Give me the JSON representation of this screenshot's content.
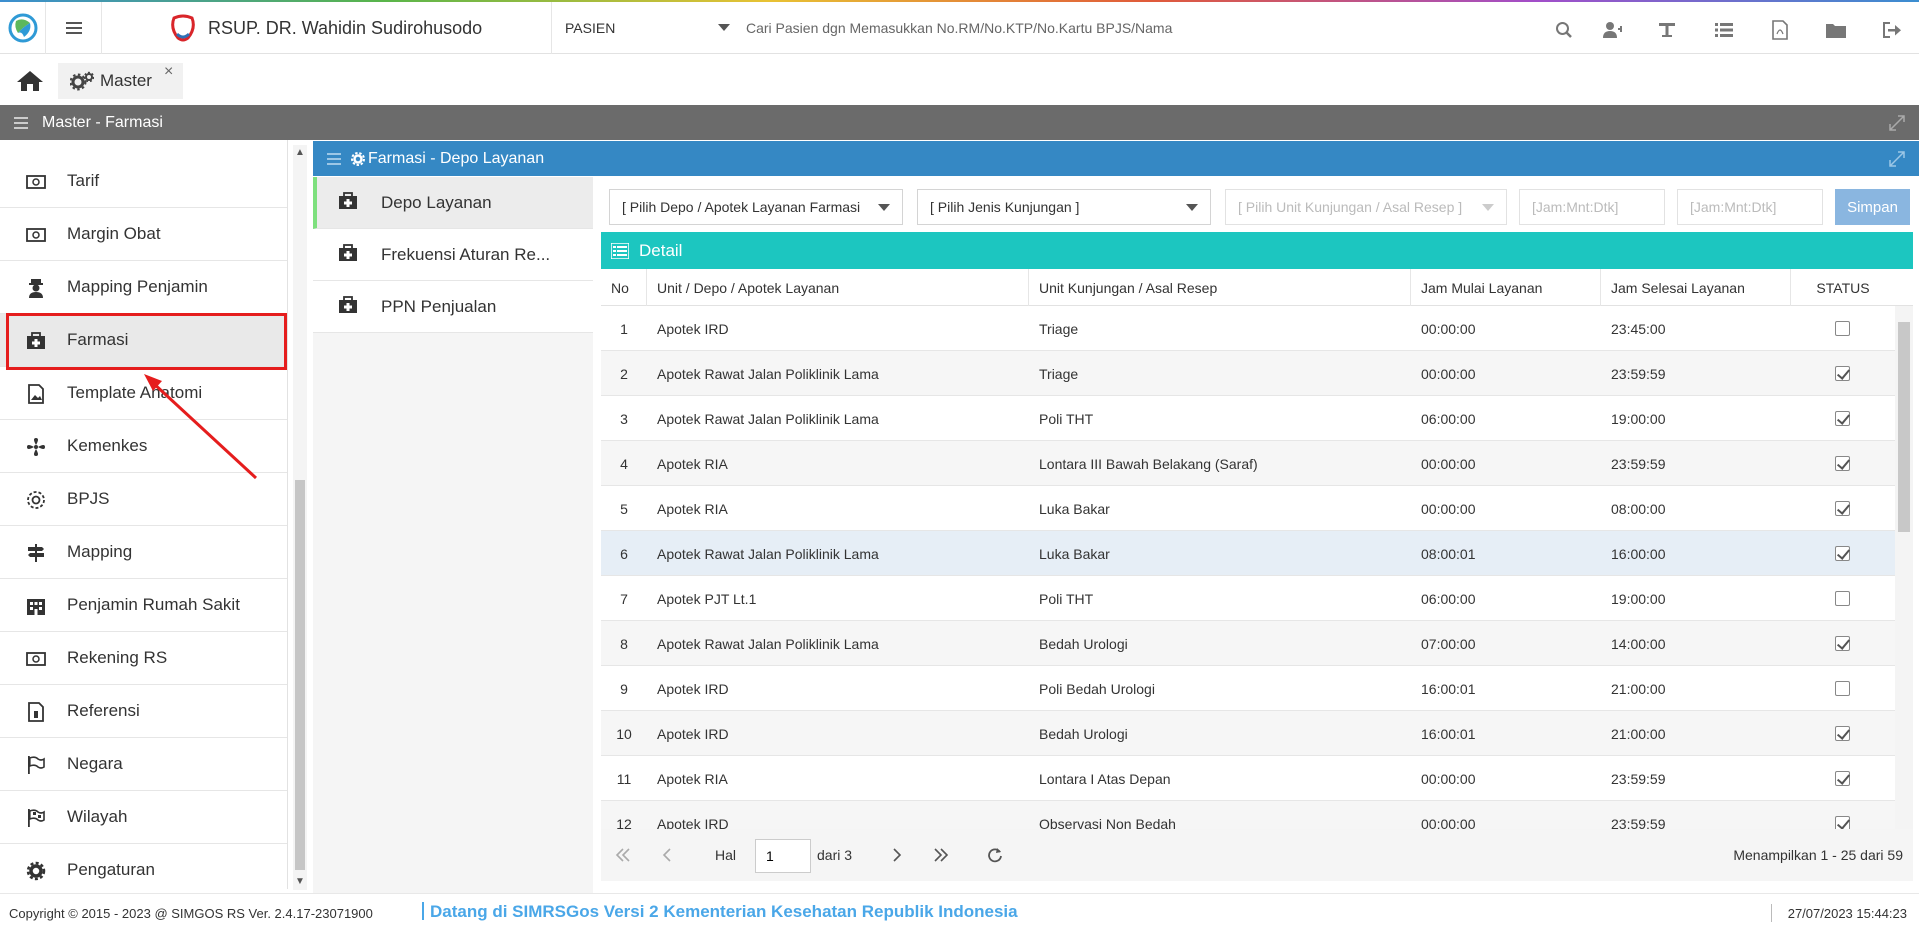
{
  "header": {
    "hospital_name": "RSUP. DR. Wahidin Sudirohusodo",
    "patient_type": "PASIEN",
    "search_placeholder": "Cari Pasien dgn Memasukkan No.RM/No.KTP/No.Kartu BPJS/Nama",
    "icons": [
      "search-icon",
      "add-user-icon",
      "text-icon",
      "list-icon",
      "pdf-icon",
      "folder-icon",
      "logout-icon"
    ]
  },
  "tabs": {
    "home_icon": "home-icon",
    "master_label": "Master",
    "close_glyph": "×"
  },
  "panel": {
    "title": "Master - Farmasi"
  },
  "sidebar": {
    "items": [
      {
        "label": "Tarif",
        "icon": "money-icon"
      },
      {
        "label": "Margin Obat",
        "icon": "money-icon"
      },
      {
        "label": "Mapping Penjamin",
        "icon": "user-secret-icon"
      },
      {
        "label": "Farmasi",
        "icon": "medkit-icon",
        "active": true
      },
      {
        "label": "Template Anatomi",
        "icon": "image-file-icon"
      },
      {
        "label": "Kemenkes",
        "icon": "fan-icon"
      },
      {
        "label": "BPJS",
        "icon": "life-ring-icon"
      },
      {
        "label": "Mapping",
        "icon": "signpost-icon"
      },
      {
        "label": "Penjamin Rumah Sakit",
        "icon": "building-icon"
      },
      {
        "label": "Rekening RS",
        "icon": "money-icon"
      },
      {
        "label": "Referensi",
        "icon": "document-icon"
      },
      {
        "label": "Negara",
        "icon": "flag-outline-icon"
      },
      {
        "label": "Wilayah",
        "icon": "flag-checkered-icon"
      },
      {
        "label": "Pengaturan",
        "icon": "gear-icon"
      }
    ]
  },
  "content": {
    "title": "Farmasi - Depo Layanan",
    "subnav": [
      {
        "label": "Depo Layanan",
        "active": true
      },
      {
        "label": "Frekuensi Aturan Re..."
      },
      {
        "label": "PPN Penjualan"
      }
    ]
  },
  "filters": {
    "depo": "[ Pilih Depo / Apotek Layanan Farmasi",
    "jenis": "[ Pilih Jenis Kunjungan ]",
    "unit": "[ Pilih Unit Kunjungan / Asal Resep ]",
    "jam_mulai_placeholder": "[Jam:Mnt:Dtk]",
    "jam_selesai_placeholder": "[Jam:Mnt:Dtk]",
    "simpan": "Simpan"
  },
  "detail": {
    "title": "Detail",
    "columns": [
      "No",
      "Unit / Depo / Apotek Layanan",
      "Unit Kunjungan / Asal Resep",
      "Jam Mulai Layanan",
      "Jam Selesai Layanan",
      "STATUS"
    ],
    "rows": [
      {
        "no": "1",
        "unit": "Apotek IRD",
        "asal": "Triage",
        "mulai": "00:00:00",
        "selesai": "23:45:00",
        "status": false
      },
      {
        "no": "2",
        "unit": "Apotek Rawat Jalan Poliklinik Lama",
        "asal": "Triage",
        "mulai": "00:00:00",
        "selesai": "23:59:59",
        "status": true
      },
      {
        "no": "3",
        "unit": "Apotek Rawat Jalan Poliklinik Lama",
        "asal": "Poli THT",
        "mulai": "06:00:00",
        "selesai": "19:00:00",
        "status": true
      },
      {
        "no": "4",
        "unit": "Apotek RIA",
        "asal": "Lontara III Bawah Belakang (Saraf)",
        "mulai": "00:00:00",
        "selesai": "23:59:59",
        "status": true
      },
      {
        "no": "5",
        "unit": "Apotek RIA",
        "asal": "Luka Bakar",
        "mulai": "00:00:00",
        "selesai": "08:00:00",
        "status": true
      },
      {
        "no": "6",
        "unit": "Apotek Rawat Jalan Poliklinik Lama",
        "asal": "Luka Bakar",
        "mulai": "08:00:01",
        "selesai": "16:00:00",
        "status": true
      },
      {
        "no": "7",
        "unit": "Apotek PJT Lt.1",
        "asal": "Poli THT",
        "mulai": "06:00:00",
        "selesai": "19:00:00",
        "status": false
      },
      {
        "no": "8",
        "unit": "Apotek Rawat Jalan Poliklinik Lama",
        "asal": "Bedah Urologi",
        "mulai": "07:00:00",
        "selesai": "14:00:00",
        "status": true
      },
      {
        "no": "9",
        "unit": "Apotek IRD",
        "asal": "Poli Bedah Urologi",
        "mulai": "16:00:01",
        "selesai": "21:00:00",
        "status": false
      },
      {
        "no": "10",
        "unit": "Apotek IRD",
        "asal": "Bedah Urologi",
        "mulai": "16:00:01",
        "selesai": "21:00:00",
        "status": true
      },
      {
        "no": "11",
        "unit": "Apotek RIA",
        "asal": "Lontara I Atas Depan",
        "mulai": "00:00:00",
        "selesai": "23:59:59",
        "status": true
      },
      {
        "no": "12",
        "unit": "Apotek IRD",
        "asal": "Observasi Non Bedah",
        "mulai": "00:00:00",
        "selesai": "23:59:59",
        "status": true
      }
    ]
  },
  "pager": {
    "hal_label": "Hal",
    "page": "1",
    "dari_label": "dari 3",
    "info": "Menampilkan 1 - 25 dari 59"
  },
  "footer": {
    "copyright": "Copyright © 2015 - 2023 @ SIMGOS RS Ver. 2.4.17-23071900",
    "marquee": "Datang di SIMRSGos Versi 2 Kementerian Kesehatan Republik Indonesia",
    "datetime": "27/07/2023 15:44:23"
  },
  "colors": {
    "panel_bar": "#6b6b6b",
    "content_title": "#3588c4",
    "detail_bar": "#1cc6c0",
    "highlight": "#e51d1d",
    "simpan": "#8ab6e0"
  }
}
